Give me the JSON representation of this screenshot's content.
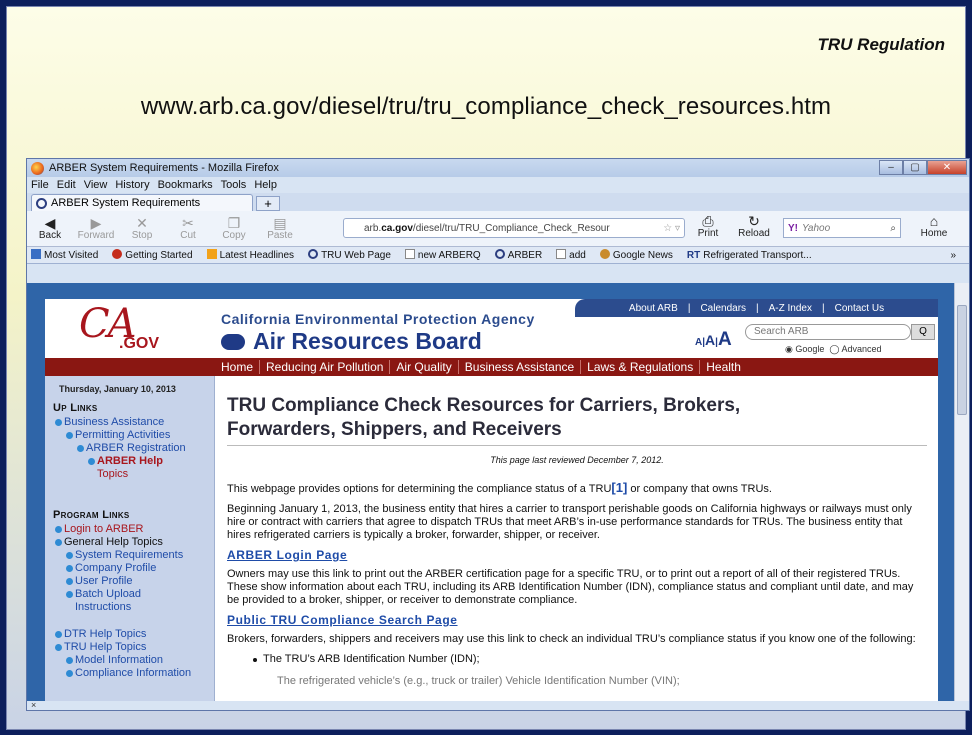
{
  "slide": {
    "title": "TRU Regulation",
    "url": "www.arb.ca.gov/diesel/tru/tru_compliance_check_resources.htm"
  },
  "browser": {
    "window_title": "ARBER System Requirements - Mozilla Firefox",
    "window_controls": [
      "–",
      "▢",
      "✕"
    ],
    "menu": [
      "File",
      "Edit",
      "View",
      "History",
      "Bookmarks",
      "Tools",
      "Help"
    ],
    "tab_label": "ARBER System Requirements",
    "new_tab": "+",
    "nav_buttons": [
      "Back",
      "Forward",
      "Stop",
      "Cut",
      "Copy",
      "Paste"
    ],
    "nav_icons": [
      "back-arrow-icon",
      "forward-arrow-icon",
      "stop-x-icon",
      "scissors-icon",
      "copy-icon",
      "paste-icon"
    ],
    "url_prefix": "arb.",
    "url_domain": "ca.gov",
    "url_rest": "/diesel/tru/TRU_Compliance_Check_Resour",
    "print": "Print",
    "reload": "Reload",
    "search_engine": "Yahoo",
    "search_logo": "Y!",
    "home": "Home",
    "bookmarks": [
      "Most Visited",
      "Getting Started",
      "Latest Headlines",
      "TRU Web Page",
      "new ARBERQ",
      "ARBER",
      "add",
      "Google News",
      "Refrigerated Transport..."
    ],
    "bookmarks_overflow": "»",
    "status_close": "×"
  },
  "site": {
    "top_links": [
      "About ARB",
      "|",
      "Calendars",
      "|",
      "A-Z Index",
      "|",
      "Contact Us"
    ],
    "logo_ca": "CA",
    "logo_gov": ".GOV",
    "agency": "California Environmental Protection Agency",
    "board": "Air Resources Board",
    "font_sizes": [
      "A",
      "|",
      "A",
      "|",
      "A"
    ],
    "search_placeholder": "Search ARB",
    "search_go": "Q",
    "radio_google": "Google",
    "radio_advanced": "Advanced",
    "nav": [
      "Home",
      "Reducing Air Pollution",
      "Air Quality",
      "Business Assistance",
      "Laws & Regulations",
      "Health"
    ],
    "left": {
      "date": "Thursday, January 10, 2013",
      "up_links_title": "Up Links",
      "up_links": [
        "Business Assistance",
        "Permitting Activities",
        "ARBER Registration"
      ],
      "current": [
        "ARBER Help",
        "Topics"
      ],
      "program_links_title": "Program Links",
      "program_links": [
        "Login to ARBER",
        "General Help Topics",
        "System Requirements",
        "Company Profile",
        "User Profile",
        "Batch Upload",
        "Instructions",
        "DTR Help Topics",
        "TRU Help Topics",
        "Model Information",
        "Compliance Information"
      ]
    },
    "main": {
      "title_line1": "TRU Compliance Check Resources for Carriers, Brokers,",
      "title_line2": "Forwarders, Shippers, and Receivers",
      "reviewed": "This page last reviewed December 7, 2012.",
      "p1": "This webpage provides options for determining the compliance status of a TRU",
      "p1_fn": "[1]",
      "p1_end": " or company that owns TRUs.",
      "p2": "Beginning January 1, 2013, the business entity that hires a carrier to transport perishable goods on California highways or railways must only hire or contract with carriers that agree to dispatch TRUs that meet ARB’s in-use performance standards for TRUs.  The business entity that hires refrigerated carriers is typically a broker, forwarder, shipper, or receiver.",
      "h_login": "ARBER Login Page",
      "p3": "Owners may use this link to print out the ARBER certification page for a specific TRU, or to print out a report of all of their registered TRUs.  These show information about each TRU, including its ARB Identification Number (IDN), compliance status and compliant until date, and may be provided to a broker, shipper, or receiver to demonstrate compliance.",
      "h_public": "Public TRU Compliance Search Page",
      "p4": "Brokers, forwarders, shippers and receivers may use this link to check an individual TRU’s compliance status if you know one of the following:",
      "bullet1": "The TRU’s ARB Identification Number (IDN);",
      "cut_line": "The refrigerated vehicle’s (e.g., truck or trailer) Vehicle Identification Number (VIN);"
    }
  }
}
